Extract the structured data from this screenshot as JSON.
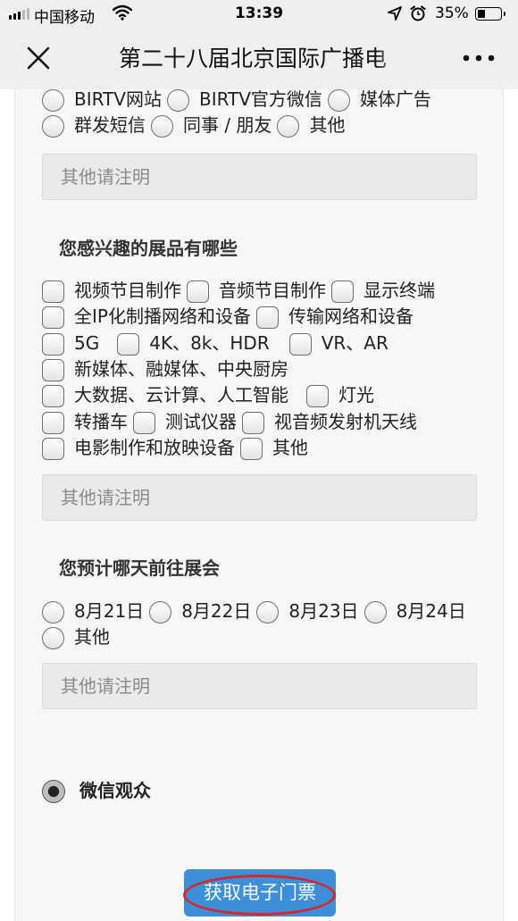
{
  "status_bar": {
    "carrier": "中国移动",
    "time": "13:39",
    "battery_percent": "35%",
    "battery_level": 0.35,
    "icons": [
      "signal-icon",
      "wifi-icon",
      "location-arrow-icon",
      "alarm-clock-icon",
      "battery-icon"
    ]
  },
  "nav": {
    "title": "第二十八届北京国际广播电",
    "icons": [
      "close-icon",
      "more-icon"
    ]
  },
  "source_question": {
    "options": [
      "BIRTV网站",
      "BIRTV官方微信",
      "媒体广告",
      "群发短信",
      "同事 / 朋友",
      "其他"
    ],
    "other_placeholder": "其他请注明"
  },
  "interest_question": {
    "label": "您感兴趣的展品有哪些",
    "options": [
      "视频节目制作",
      "音频节目制作",
      "显示终端",
      "全IP化制播网络和设备",
      "传输网络和设备",
      "5G",
      "4K、8k、HDR",
      "VR、AR",
      "新媒体、融媒体、中央厨房",
      "大数据、云计算、人工智能",
      "灯光",
      "转播车",
      "测试仪器",
      "视音频发射机天线",
      "电影制作和放映设备",
      "其他"
    ],
    "other_placeholder": "其他请注明"
  },
  "date_question": {
    "label": "您预计哪天前往展会",
    "options": [
      "8月21日",
      "8月22日",
      "8月23日",
      "8月24日",
      "其他"
    ],
    "other_placeholder": "其他请注明"
  },
  "audience": {
    "label": "微信观众",
    "selected": true
  },
  "ticket_button": {
    "label": "获取电子门票",
    "highlight_color": "#d8262c"
  },
  "colors": {
    "button_blue": "#3d8fd8",
    "page_bg": "#f7f7f7",
    "bar_bg": "#efefef"
  }
}
